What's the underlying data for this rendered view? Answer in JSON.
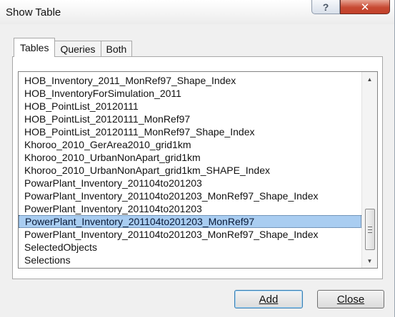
{
  "window": {
    "title": "Show Table",
    "help_glyph": "?",
    "close_glyph": "✕"
  },
  "tabs": [
    {
      "label": "Tables",
      "active": true
    },
    {
      "label": "Queries",
      "active": false
    },
    {
      "label": "Both",
      "active": false
    }
  ],
  "list": {
    "items": [
      "HOB_Inventory_2011_MonRef97_Shape_Index",
      "HOB_InventoryForSimulation_2011",
      "HOB_PointList_20120111",
      "HOB_PointList_20120111_MonRef97",
      "HOB_PointList_20120111_MonRef97_Shape_Index",
      "Khoroo_2010_GerArea2010_grid1km",
      "Khoroo_2010_UrbanNonApart_grid1km",
      "Khoroo_2010_UrbanNonApart_grid1km_SHAPE_Index",
      "PowarPlant_Inventory_201104to201203",
      "PowarPlant_Inventory_201104to201203_MonRef97_Shape_Index",
      "PowerPlant_Inventory_201104to201203",
      "PowerPlant_Inventory_201104to201203_MonRef97",
      "PowerPlant_Inventory_201104to201203_MonRef97_Shape_Index",
      "SelectedObjects",
      "Selections"
    ],
    "selected": "PowerPlant_Inventory_201104to201203_MonRef97"
  },
  "scrollbar": {
    "up_icon": "▲",
    "down_icon": "▼"
  },
  "buttons": {
    "add_label": "Add",
    "close_label": "Close"
  }
}
